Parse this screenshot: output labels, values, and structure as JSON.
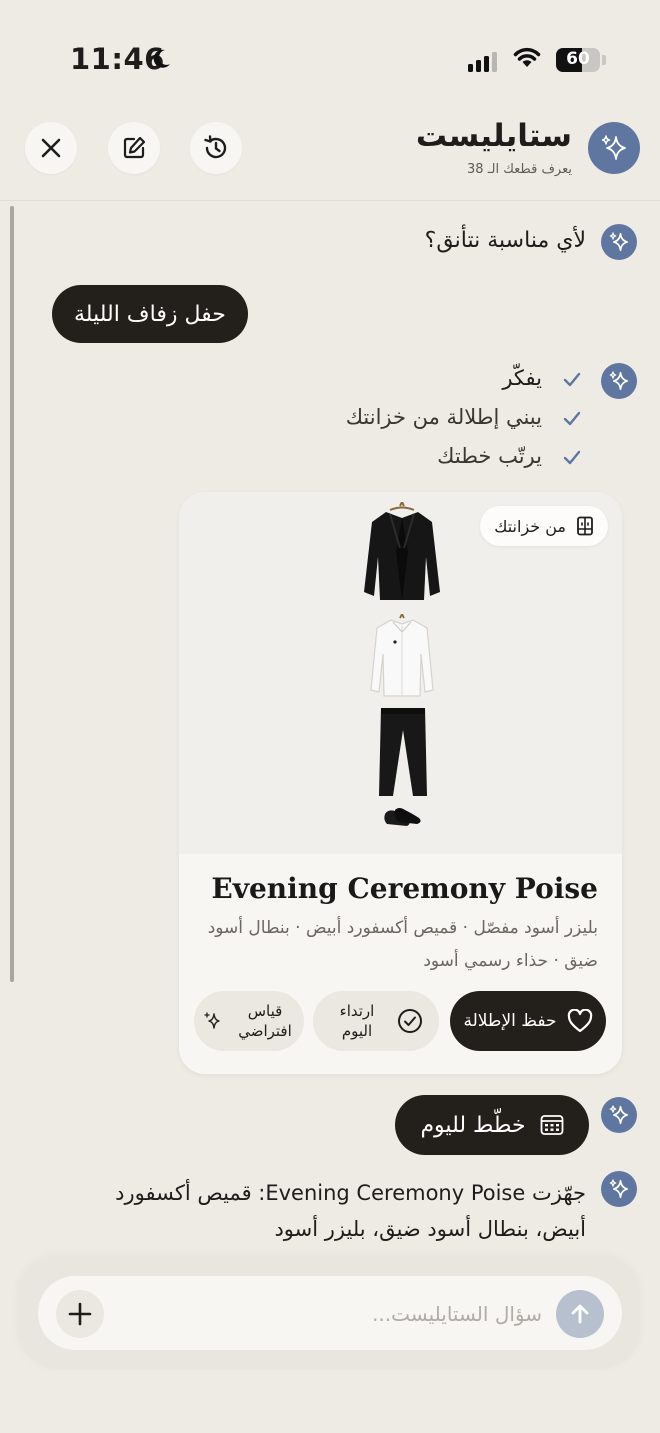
{
  "status_bar": {
    "time": "11:46",
    "battery": "60"
  },
  "header": {
    "title": "ستايليست",
    "subtitle": "يعرف قطعك الـ 38"
  },
  "chat": {
    "ai_question": "لأي مناسبة نتأنق؟",
    "user_message": "حفل زفاف الليلة",
    "steps": [
      {
        "label": "يفكّر",
        "done": true
      },
      {
        "label": "يبني إطلالة من خزانتك",
        "done": true
      },
      {
        "label": "يرتّب خطتك",
        "done": true
      }
    ],
    "outfit_card": {
      "badge": "من خزانتك",
      "title": "Evening Ceremony Poise",
      "description": "بليزر أسود مفصّل · قميص أكسفورد أبيض · بنطال أسود ضيق · حذاء رسمي أسود",
      "items": [
        "black-blazer",
        "white-oxford-shirt",
        "black-slim-trousers",
        "black-dress-shoes"
      ],
      "save_label": "حفظ الإطلالة",
      "wear_today_label": "ارتداء اليوم",
      "virtual_tryon_label": "قياس افتراضي"
    },
    "plan_button": "خطّط لليوم",
    "final_message": "جهّزت Evening Ceremony Poise: قميص أكسفورد أبيض، بنطال أسود ضيق، بليزر أسود"
  },
  "composer": {
    "placeholder": "سؤال الستايليست..."
  },
  "colors": {
    "accent": "#5f77a0",
    "dark": "#231f1b",
    "background": "#eeebe5"
  },
  "icons": [
    "close-icon",
    "compose-icon",
    "history-icon",
    "sparkle-icon",
    "check-icon",
    "wardrobe-icon",
    "heart-icon",
    "checkmark-circle-icon",
    "sparkle-small-icon",
    "calendar-icon",
    "plus-icon",
    "arrow-up-icon"
  ]
}
